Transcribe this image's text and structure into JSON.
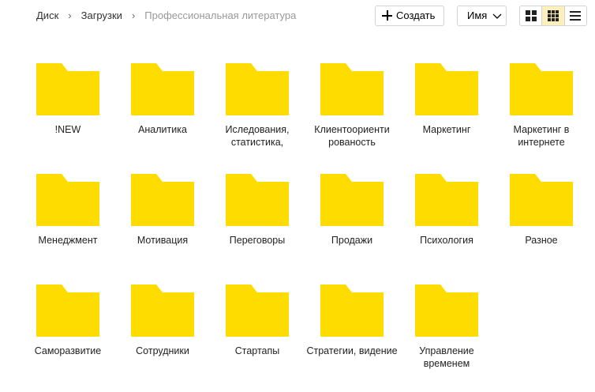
{
  "breadcrumb": [
    "Диск",
    "Загрузки",
    "Профессиональная литература"
  ],
  "toolbar": {
    "create_label": "Создать",
    "sort_label": "Имя",
    "view_modes": [
      "large-tiles",
      "small-tiles",
      "list"
    ],
    "active_view": "small-tiles"
  },
  "colors": {
    "folder": "#ffdc00",
    "folder_tab": "#ffdc00",
    "active_view_bg": "#fdf0bc"
  },
  "folders": [
    {
      "name": "!NEW"
    },
    {
      "name": "Аналитика"
    },
    {
      "name": "Иследования, статистика,"
    },
    {
      "name": "Клиентоориенти рованость"
    },
    {
      "name": "Маркетинг"
    },
    {
      "name": "Маркетинг в интернете"
    },
    {
      "name": "Менеджмент"
    },
    {
      "name": "Мотивация"
    },
    {
      "name": "Переговоры"
    },
    {
      "name": "Продажи"
    },
    {
      "name": "Психология"
    },
    {
      "name": "Разное"
    },
    {
      "name": "Саморазвитие"
    },
    {
      "name": "Сотрудники"
    },
    {
      "name": "Стартапы"
    },
    {
      "name": "Стратегии, видение"
    },
    {
      "name": "Управление временем"
    }
  ]
}
